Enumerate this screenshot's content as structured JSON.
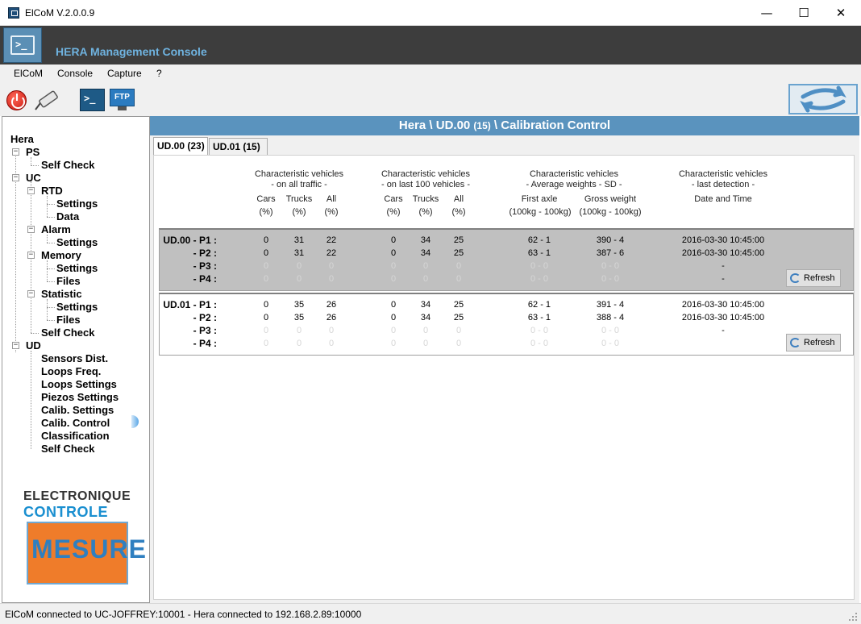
{
  "window": {
    "title": "ElCoM V.2.0.0.9",
    "minimize": "—",
    "maximize": "☐",
    "close": "✕"
  },
  "banner": {
    "app_name": "HERA Management Console",
    "terminal_glyph": ">_"
  },
  "menu": [
    "ElCoM",
    "Console",
    "Capture",
    "?"
  ],
  "toolbar": {
    "ftp_label": "FTP",
    "terminal_glyph": ">_"
  },
  "tree": {
    "root": "Hera",
    "ps": "PS",
    "ps_self_check": "Self Check",
    "uc": "UC",
    "rtd": "RTD",
    "rtd_settings": "Settings",
    "rtd_data": "Data",
    "alarm": "Alarm",
    "alarm_settings": "Settings",
    "memory": "Memory",
    "memory_settings": "Settings",
    "memory_files": "Files",
    "statistic": "Statistic",
    "statistic_settings": "Settings",
    "statistic_files": "Files",
    "uc_self_check": "Self Check",
    "ud": "UD",
    "sensors_dist": "Sensors Dist.",
    "loops_freq": "Loops Freq.",
    "loops_settings": "Loops Settings",
    "piezos_settings": "Piezos Settings",
    "calib_settings": "Calib. Settings",
    "calib_control": "Calib. Control",
    "classification": "Classification",
    "ud_self_check": "Self Check"
  },
  "logo": {
    "line1": "ELECTRONIQUE",
    "line2": "CONTROLE",
    "line3": "MESURE"
  },
  "header": {
    "prefix": "Hera \\ UD.00 ",
    "count": "(15)",
    "suffix": " \\ Calibration Control"
  },
  "tabs": [
    "UD.00 (23)",
    "UD.01 (15)"
  ],
  "columns": {
    "g1_title": "Characteristic vehicles",
    "g1_sub": "- on all traffic -",
    "g2_title": "Characteristic vehicles",
    "g2_sub": "- on last 100 vehicles -",
    "g3_title": "Characteristic vehicles",
    "g3_sub": "- Average weights - SD -",
    "g4_title": "Characteristic vehicles",
    "g4_sub": "- last detection -",
    "cars": "Cars",
    "trucks": "Trucks",
    "all": "All",
    "pct": "(%)",
    "first_axle": "First axle",
    "gross_weight": "Gross weight",
    "unit": "(100kg - 100kg)",
    "date_time": "Date and Time"
  },
  "groups": [
    {
      "rows": [
        {
          "label": "UD.00 - P1 :",
          "cars1": "0",
          "trucks1": "31",
          "all1": "22",
          "cars2": "0",
          "trucks2": "34",
          "all2": "25",
          "axle": "62 - 1",
          "gross": "390 - 4",
          "date": "2016-03-30 10:45:00",
          "dim": false
        },
        {
          "label": "- P2 :",
          "cars1": "0",
          "trucks1": "31",
          "all1": "22",
          "cars2": "0",
          "trucks2": "34",
          "all2": "25",
          "axle": "63 - 1",
          "gross": "387 - 6",
          "date": "2016-03-30 10:45:00",
          "dim": false
        },
        {
          "label": "- P3 :",
          "cars1": "0",
          "trucks1": "0",
          "all1": "0",
          "cars2": "0",
          "trucks2": "0",
          "all2": "0",
          "axle": "0 - 0",
          "gross": "0 - 0",
          "date": "-",
          "dim": true
        },
        {
          "label": "- P4 :",
          "cars1": "0",
          "trucks1": "0",
          "all1": "0",
          "cars2": "0",
          "trucks2": "0",
          "all2": "0",
          "axle": "0 - 0",
          "gross": "0 - 0",
          "date": "-",
          "dim": true
        }
      ],
      "refresh": "Refresh"
    },
    {
      "rows": [
        {
          "label": "UD.01 - P1 :",
          "cars1": "0",
          "trucks1": "35",
          "all1": "26",
          "cars2": "0",
          "trucks2": "34",
          "all2": "25",
          "axle": "62 - 1",
          "gross": "391 - 4",
          "date": "2016-03-30 10:45:00",
          "dim": false
        },
        {
          "label": "- P2 :",
          "cars1": "0",
          "trucks1": "35",
          "all1": "26",
          "cars2": "0",
          "trucks2": "34",
          "all2": "25",
          "axle": "63 - 1",
          "gross": "388 - 4",
          "date": "2016-03-30 10:45:00",
          "dim": false
        },
        {
          "label": "- P3 :",
          "cars1": "0",
          "trucks1": "0",
          "all1": "0",
          "cars2": "0",
          "trucks2": "0",
          "all2": "0",
          "axle": "0 - 0",
          "gross": "0 - 0",
          "date": "-",
          "dim": true
        },
        {
          "label": "- P4 :",
          "cars1": "0",
          "trucks1": "0",
          "all1": "0",
          "cars2": "0",
          "trucks2": "0",
          "all2": "0",
          "axle": "0 - 0",
          "gross": "0 - 0",
          "date": "",
          "dim": true
        }
      ],
      "refresh": "Refresh"
    }
  ],
  "status": {
    "text": "ElCoM connected to UC-JOFFREY:10001  -  Hera connected to 192.168.2.89:10000"
  },
  "colors": {
    "banner": "#3d3d3d",
    "header": "#5a93be",
    "accent": "#6fb3e0"
  }
}
